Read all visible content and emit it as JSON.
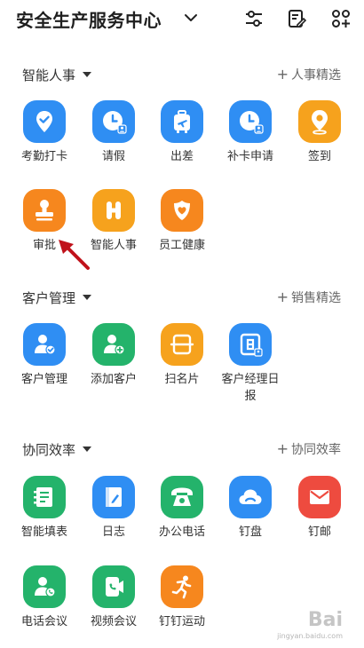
{
  "header": {
    "title": "安全生产服务中心",
    "icons": [
      "chevron-down-icon",
      "sliders-icon",
      "edit-checklist-icon",
      "grid-add-icon"
    ]
  },
  "sections": [
    {
      "name": "智能人事",
      "action": "人事精选",
      "apps": [
        {
          "label": "考勤打卡",
          "icon": "location-check-icon",
          "color": "#2f8ef3"
        },
        {
          "label": "请假",
          "icon": "clock-user-icon",
          "color": "#2f8ef3"
        },
        {
          "label": "出差",
          "icon": "suitcase-plane-icon",
          "color": "#2f8ef3"
        },
        {
          "label": "补卡申请",
          "icon": "clock-user-icon",
          "color": "#2f8ef3"
        },
        {
          "label": "签到",
          "icon": "location-pin-icon",
          "color": "#f6a21d"
        },
        {
          "label": "审批",
          "icon": "stamp-icon",
          "color": "#f6871e"
        },
        {
          "label": "智能人事",
          "icon": "h-letter-icon",
          "color": "#f6a21d"
        },
        {
          "label": "员工健康",
          "icon": "heart-shield-icon",
          "color": "#f6871e"
        }
      ]
    },
    {
      "name": "客户管理",
      "action": "销售精选",
      "apps": [
        {
          "label": "客户管理",
          "icon": "user-check-icon",
          "color": "#2f8ef3"
        },
        {
          "label": "添加客户",
          "icon": "user-add-icon",
          "color": "#24b36b"
        },
        {
          "label": "扫名片",
          "icon": "scan-card-icon",
          "color": "#f6a21d"
        },
        {
          "label": "客户经理日报",
          "icon": "calendar-day-icon",
          "color": "#2f8ef3"
        }
      ]
    },
    {
      "name": "协同效率",
      "action": "协同效率",
      "apps": [
        {
          "label": "智能填表",
          "icon": "form-icon",
          "color": "#24b36b"
        },
        {
          "label": "日志",
          "icon": "notebook-icon",
          "color": "#2f8ef3"
        },
        {
          "label": "办公电话",
          "icon": "desk-phone-icon",
          "color": "#24b36b"
        },
        {
          "label": "钉盘",
          "icon": "cloud-icon",
          "color": "#2f8ef3"
        },
        {
          "label": "钉邮",
          "icon": "mail-icon",
          "color": "#ee4b3f"
        },
        {
          "label": "电话会议",
          "icon": "user-phone-icon",
          "color": "#24b36b"
        },
        {
          "label": "视频会议",
          "icon": "video-phone-icon",
          "color": "#24b36b"
        },
        {
          "label": "钉钉运动",
          "icon": "running-icon",
          "color": "#f6871e"
        }
      ]
    }
  ],
  "watermark": {
    "text": "Bai",
    "sub": "jingyan.baidu.com"
  }
}
